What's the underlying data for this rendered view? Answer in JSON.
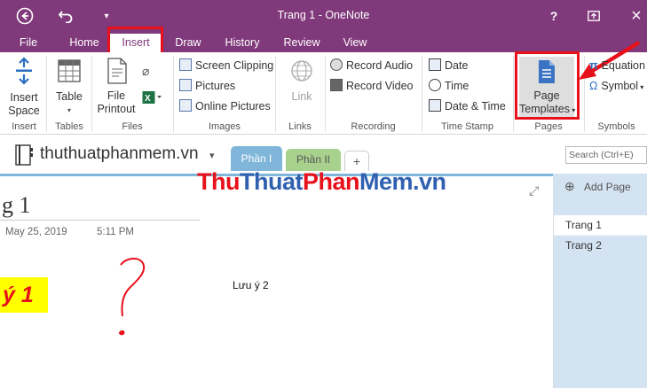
{
  "window": {
    "title": "Trang 1 - OneNote",
    "help": "?",
    "close": "×"
  },
  "tabs": [
    {
      "label": "File"
    },
    {
      "label": "Home"
    },
    {
      "label": "Insert"
    },
    {
      "label": "Draw"
    },
    {
      "label": "History"
    },
    {
      "label": "Review"
    },
    {
      "label": "View"
    }
  ],
  "ribbon": {
    "insert_space": "Insert Space",
    "table": "Table",
    "file_printout": "File Printout",
    "screen_clipping": "Screen Clipping",
    "pictures": "Pictures",
    "online_pictures": "Online Pictures",
    "link": "Link",
    "record_audio": "Record Audio",
    "record_video": "Record Video",
    "date": "Date",
    "time": "Time",
    "date_time": "Date & Time",
    "page_templates_1": "Page",
    "page_templates_2": "Templates",
    "equation": "Equation",
    "symbol": "Symbol",
    "groups": [
      "Insert",
      "Tables",
      "Files",
      "Images",
      "Links",
      "Recording",
      "Time Stamp",
      "Pages",
      "Symbols"
    ]
  },
  "notebook": {
    "name": "thuthuatphanmem.vn",
    "sections": [
      "Phần I",
      "Phần II"
    ],
    "add_section": "+",
    "search_placeholder": "Search (Ctrl+E)"
  },
  "page": {
    "title_fragment": "g 1",
    "date": "May 25, 2019",
    "time": "5:11 PM",
    "note1": "ý 1",
    "note2": "Lưu ý 2"
  },
  "watermark": {
    "part1": "Thu",
    "part2": "Thuat",
    "part3": "Phan",
    "part4": "Mem",
    "part5": ".vn"
  },
  "pages_pane": {
    "add_page": "Add Page",
    "items": [
      "Trang 1",
      "Trang 2"
    ]
  }
}
